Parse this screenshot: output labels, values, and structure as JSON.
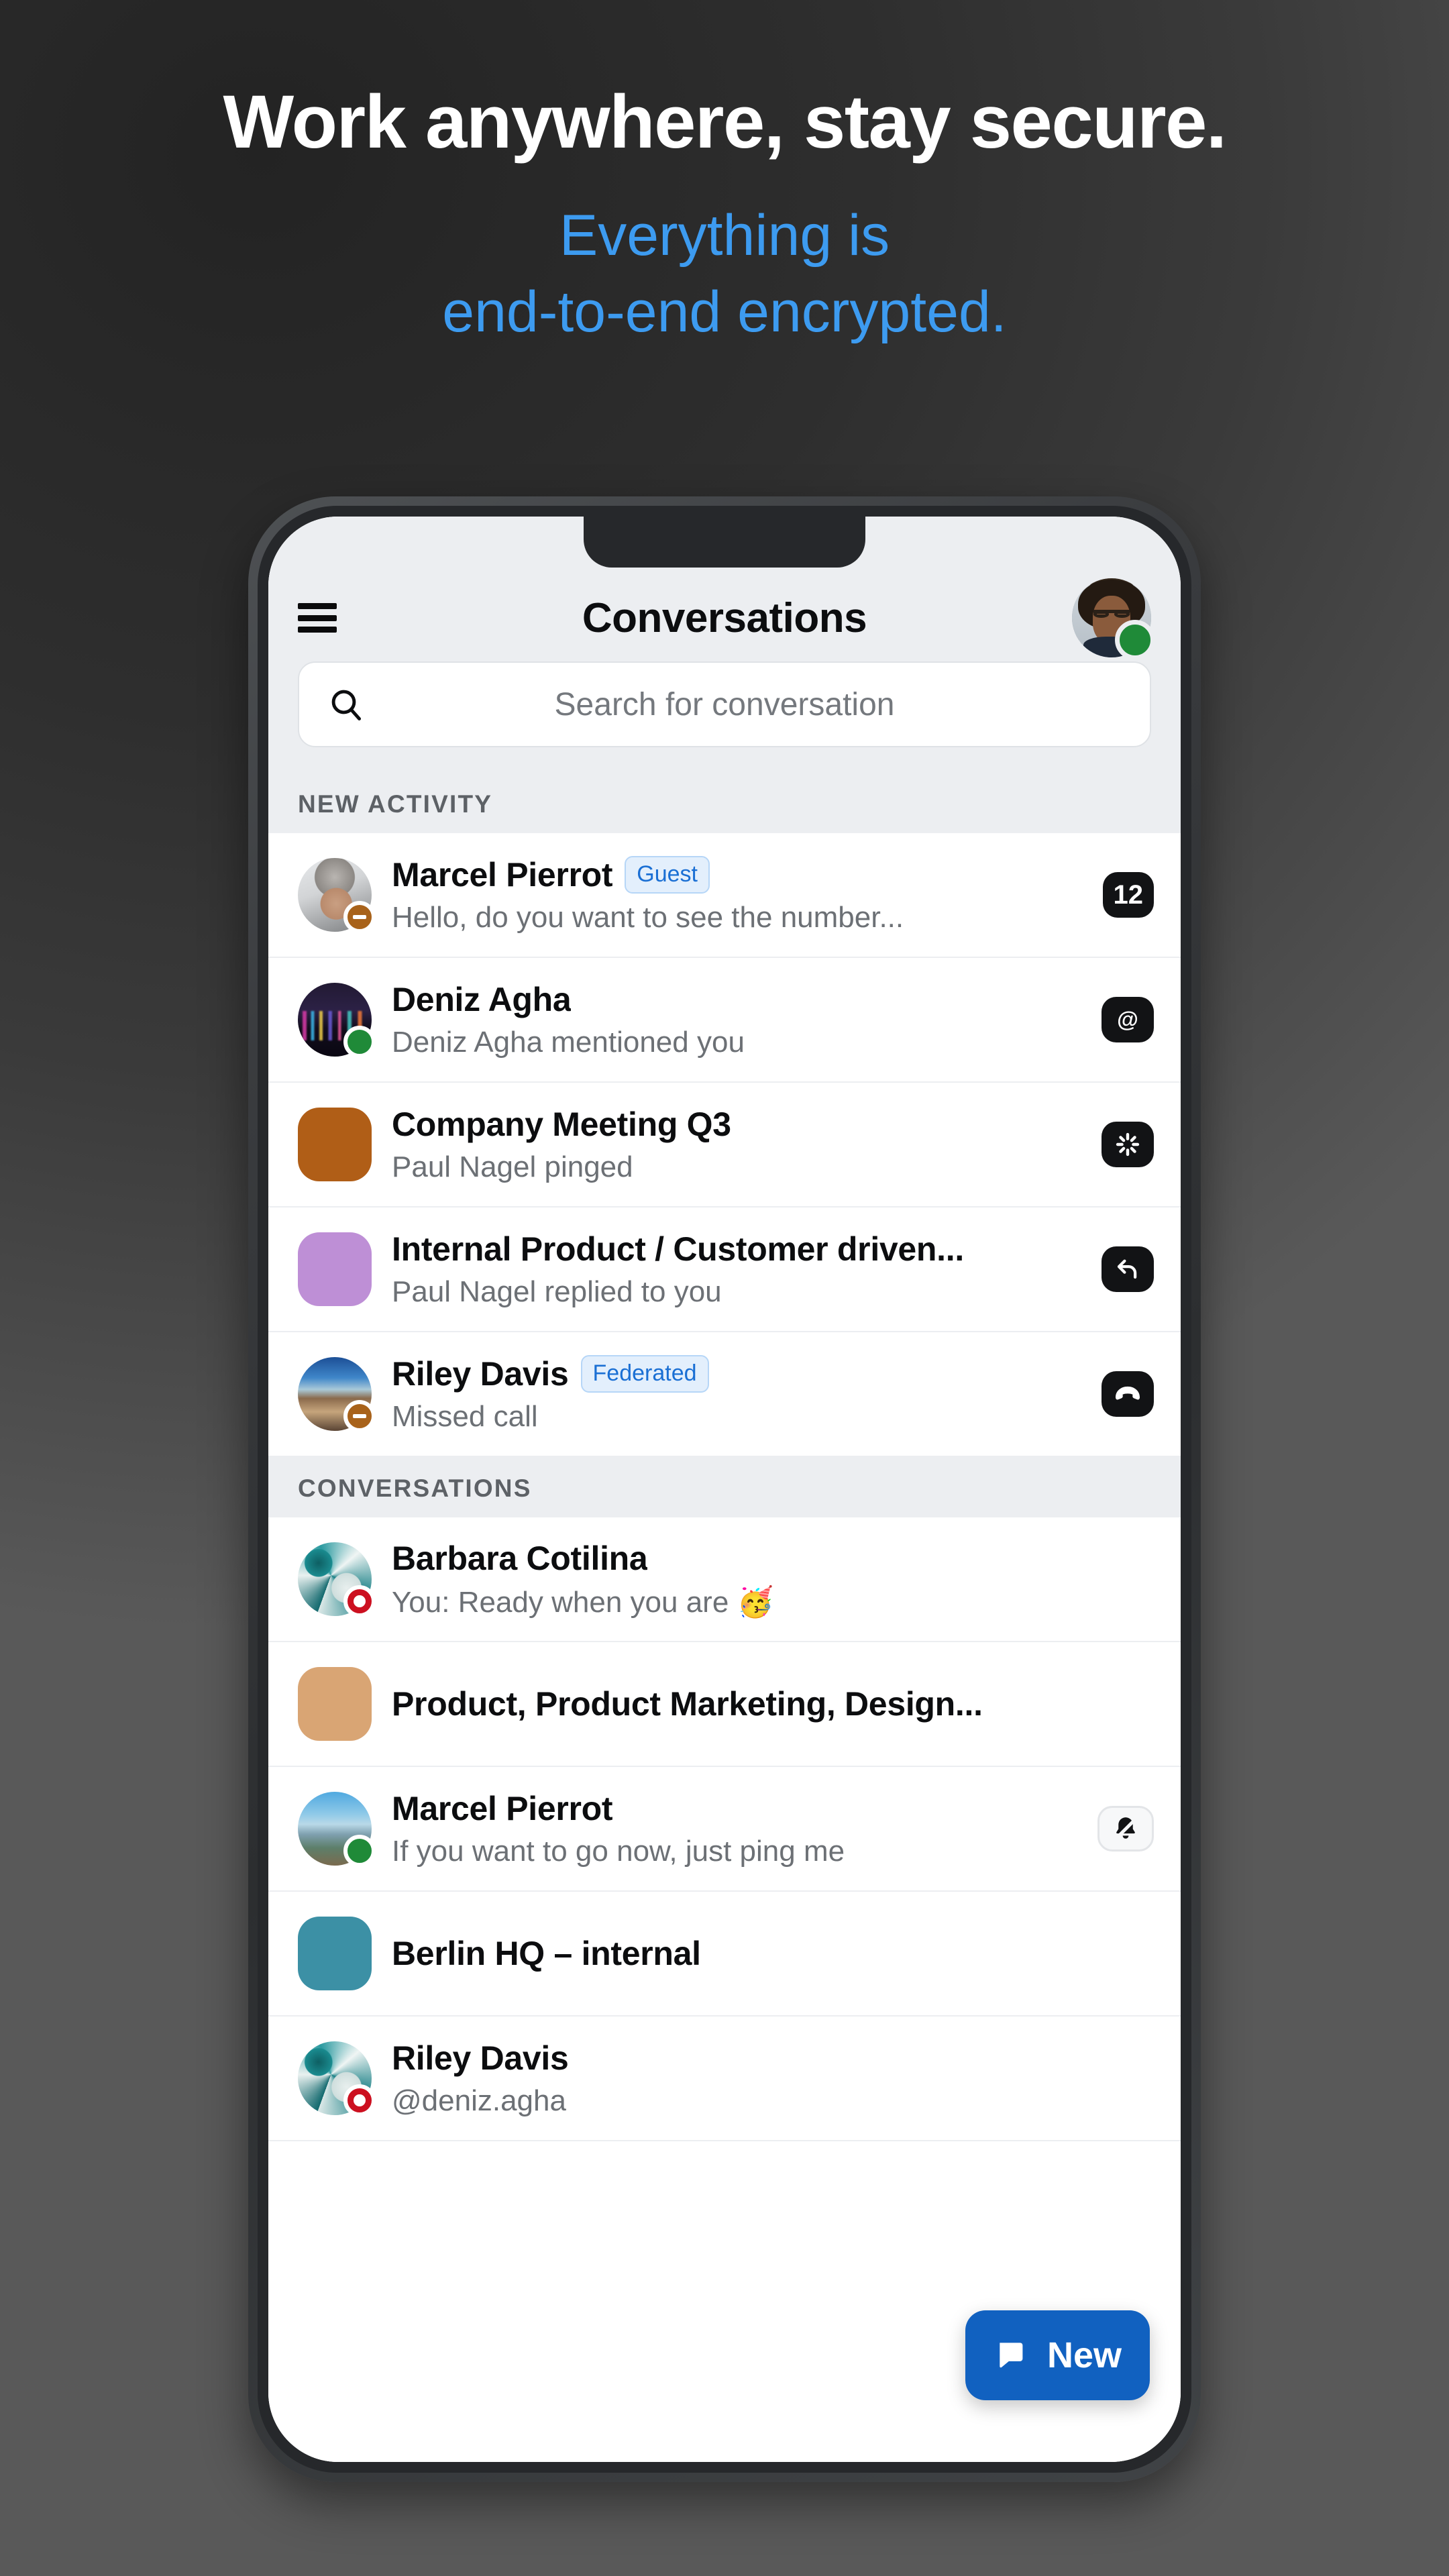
{
  "promo": {
    "title": "Work anywhere, stay secure.",
    "subtitle_line1": "Everything is",
    "subtitle_line2": "end-to-end encrypted.",
    "title_color": "#ffffff",
    "subtitle_color": "#3d9bf0"
  },
  "app": {
    "title": "Conversations",
    "menu_icon": "hamburger-menu-icon",
    "profile_status": "online",
    "accent_color": "#1161c0"
  },
  "search": {
    "placeholder": "Search for conversation",
    "value": "",
    "icon": "search-icon"
  },
  "sections": [
    {
      "header": "NEW ACTIVITY",
      "rows": [
        {
          "title": "Marcel Pierrot",
          "tag": "Guest",
          "subtitle": "Hello, do you want to see the number...",
          "badge_text": "12",
          "badge_icon": "unread-count-badge",
          "avatar_kind": "photo",
          "avatar_style": "ph-grayman",
          "avatar_shape": "circle",
          "status": "dnd"
        },
        {
          "title": "Deniz Agha",
          "tag": "",
          "subtitle": "Deniz Agha mentioned you",
          "badge_text": "@",
          "badge_icon": "mention-badge",
          "avatar_kind": "photo",
          "avatar_style": "ph-city",
          "avatar_shape": "circle",
          "status": "online"
        },
        {
          "title": "Company Meeting Q3",
          "tag": "",
          "subtitle": "Paul Nagel pinged",
          "badge_text": "",
          "badge_icon": "ping-badge",
          "avatar_kind": "color",
          "avatar_color": "#b05e17",
          "avatar_shape": "square",
          "status": ""
        },
        {
          "title": "Internal Product / Customer driven...",
          "tag": "",
          "subtitle": "Paul Nagel replied to you",
          "badge_text": "",
          "badge_icon": "reply-badge",
          "avatar_kind": "color",
          "avatar_color": "#be8fd6",
          "avatar_shape": "square",
          "status": ""
        },
        {
          "title": "Riley Davis",
          "tag": "Federated",
          "subtitle": "Missed call",
          "badge_text": "",
          "badge_icon": "missed-call-badge",
          "avatar_kind": "photo",
          "avatar_style": "ph-canyon",
          "avatar_shape": "circle",
          "status": "dnd"
        }
      ]
    },
    {
      "header": "CONVERSATIONS",
      "rows": [
        {
          "title": "Barbara Cotilina",
          "tag": "",
          "subtitle": "You: Ready when you are 🥳",
          "badge_text": "",
          "badge_icon": "",
          "avatar_kind": "photo",
          "avatar_style": "ph-marble",
          "avatar_shape": "circle",
          "status": "away"
        },
        {
          "title": "Product, Product Marketing, Design...",
          "tag": "",
          "subtitle": "",
          "badge_text": "",
          "badge_icon": "",
          "avatar_kind": "color",
          "avatar_color": "#d9a574",
          "avatar_shape": "square",
          "status": ""
        },
        {
          "title": "Marcel Pierrot",
          "tag": "",
          "subtitle": "If you want to go now, just ping me",
          "badge_text": "",
          "badge_icon": "muted-bell-badge",
          "avatar_kind": "photo",
          "avatar_style": "ph-lake",
          "avatar_shape": "circle",
          "status": "online"
        },
        {
          "title": "Berlin HQ – internal",
          "tag": "",
          "subtitle": "",
          "badge_text": "",
          "badge_icon": "",
          "avatar_kind": "color",
          "avatar_color": "#3c90a5",
          "avatar_shape": "square",
          "status": ""
        },
        {
          "title": "Riley Davis",
          "tag": "",
          "subtitle": "@deniz.agha",
          "badge_text": "",
          "badge_icon": "",
          "avatar_kind": "photo",
          "avatar_style": "ph-marble",
          "avatar_shape": "circle",
          "status": "away"
        }
      ]
    }
  ],
  "fab": {
    "label": "New",
    "icon": "new-message-icon"
  }
}
